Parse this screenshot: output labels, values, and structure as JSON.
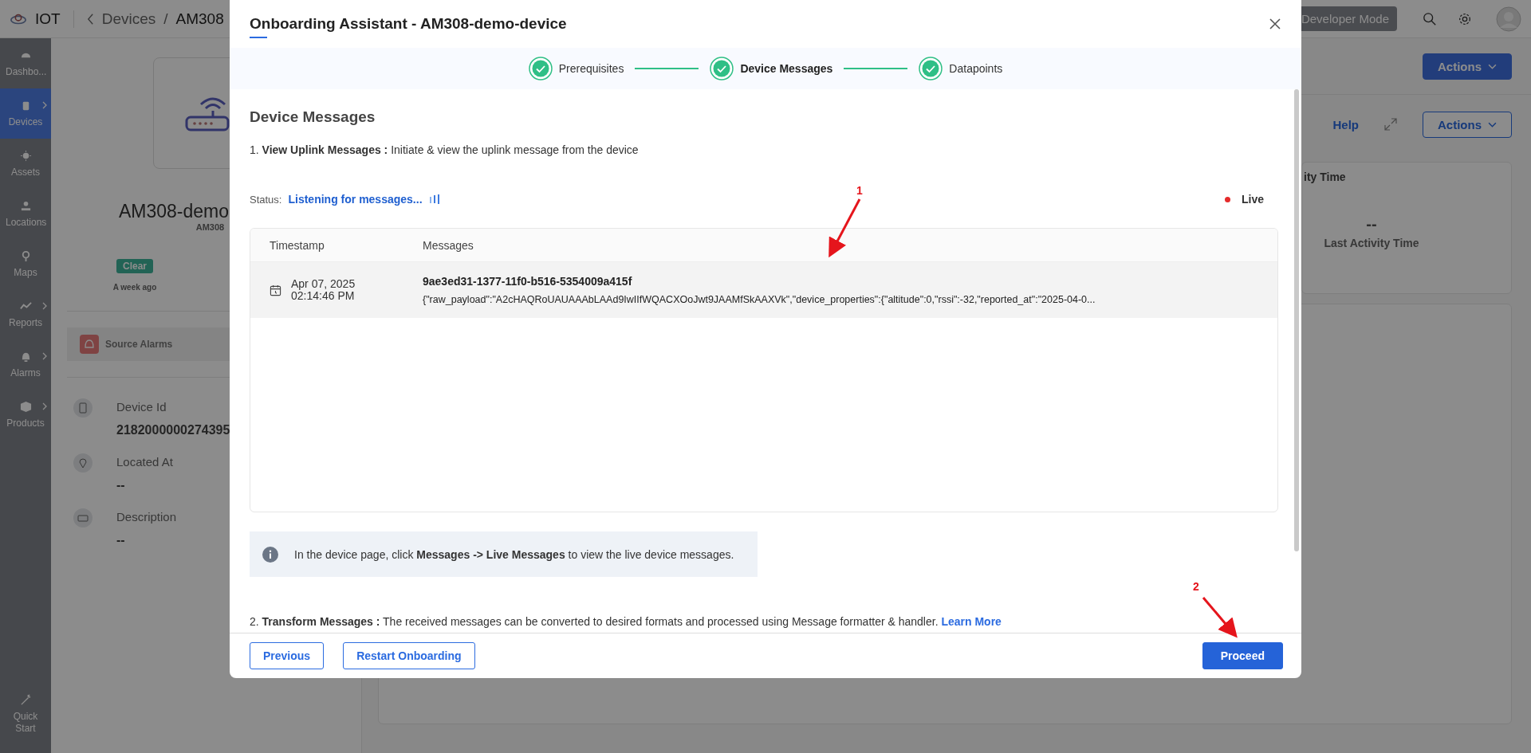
{
  "app": {
    "name": "IOT"
  },
  "breadcrumb": [
    "Devices",
    "/",
    "AM308"
  ],
  "top_bar": {
    "mode_button": "Developer Mode"
  },
  "sidebar": {
    "items": [
      {
        "label": "Dashbo...",
        "selected": false,
        "expandable": false
      },
      {
        "label": "Devices",
        "selected": true,
        "expandable": true
      },
      {
        "label": "Assets",
        "selected": false,
        "expandable": false
      },
      {
        "label": "Locations",
        "selected": false,
        "expandable": false
      },
      {
        "label": "Maps",
        "selected": false,
        "expandable": false
      },
      {
        "label": "Reports",
        "selected": false,
        "expandable": true
      },
      {
        "label": "Alarms",
        "selected": false,
        "expandable": true
      },
      {
        "label": "Products",
        "selected": false,
        "expandable": true
      }
    ],
    "quick_start": "Quick Start"
  },
  "device": {
    "name": "AM308-demo",
    "model": "AM308",
    "status": {
      "label": "Clear",
      "time": "A week ago"
    },
    "source_alarms": "Source Alarms",
    "details": [
      {
        "label": "Device Id",
        "value": "2182000000274395"
      },
      {
        "label": "Located At",
        "value": "--"
      },
      {
        "label": "Description",
        "value": "--"
      }
    ]
  },
  "header_actions": {
    "actions": "Actions"
  },
  "panel": {
    "help": "Help",
    "actions": "Actions",
    "card": {
      "title": "ity Time",
      "value": "--",
      "caption": "Last Activity Time"
    }
  },
  "modal": {
    "title": "Onboarding Assistant - AM308-demo-device",
    "steps": [
      {
        "label": "Prerequisites",
        "completed": true,
        "selected": false
      },
      {
        "label": "Device Messages",
        "completed": true,
        "selected": true
      },
      {
        "label": "Datapoints",
        "completed": true,
        "selected": false
      }
    ],
    "section_title": "Device Messages",
    "step_1": "1. **View Uplink Messages :** Initiate & view the uplink message from the device",
    "status_label": "Status:",
    "status_text": "Listening for messages...",
    "live": "Live",
    "table": {
      "columns": [
        "Timestamp",
        "Messages"
      ],
      "rows": [
        {
          "date": "Apr 07, 2025",
          "time": "02:14:46 PM",
          "id": "9ae3ed31-1377-11f0-b516-5354009a415f",
          "payload": "{\"raw_payload\":\"A2cHAQRoUAUAAAbLAAd9IwIIfWQACXOoJwt9JAAMfSkAAXVk\",\"device_properties\":{\"altitude\":0,\"rssi\":-32,\"reported_at\":\"2025-04-0..."
        }
      ]
    },
    "info": "In the device page, click **Messages -> Live Messages** to view the live device messages.",
    "step_2": "2. **Transform Messages :** The received messages can be converted to desired formats and processed using Message formatter & handler.",
    "step_2_link": "Learn More",
    "buttons": {
      "previous": "Previous",
      "restart": "Restart Onboarding",
      "proceed": "Proceed"
    }
  },
  "annotations": [
    {
      "label": "1"
    },
    {
      "label": "2"
    }
  ]
}
